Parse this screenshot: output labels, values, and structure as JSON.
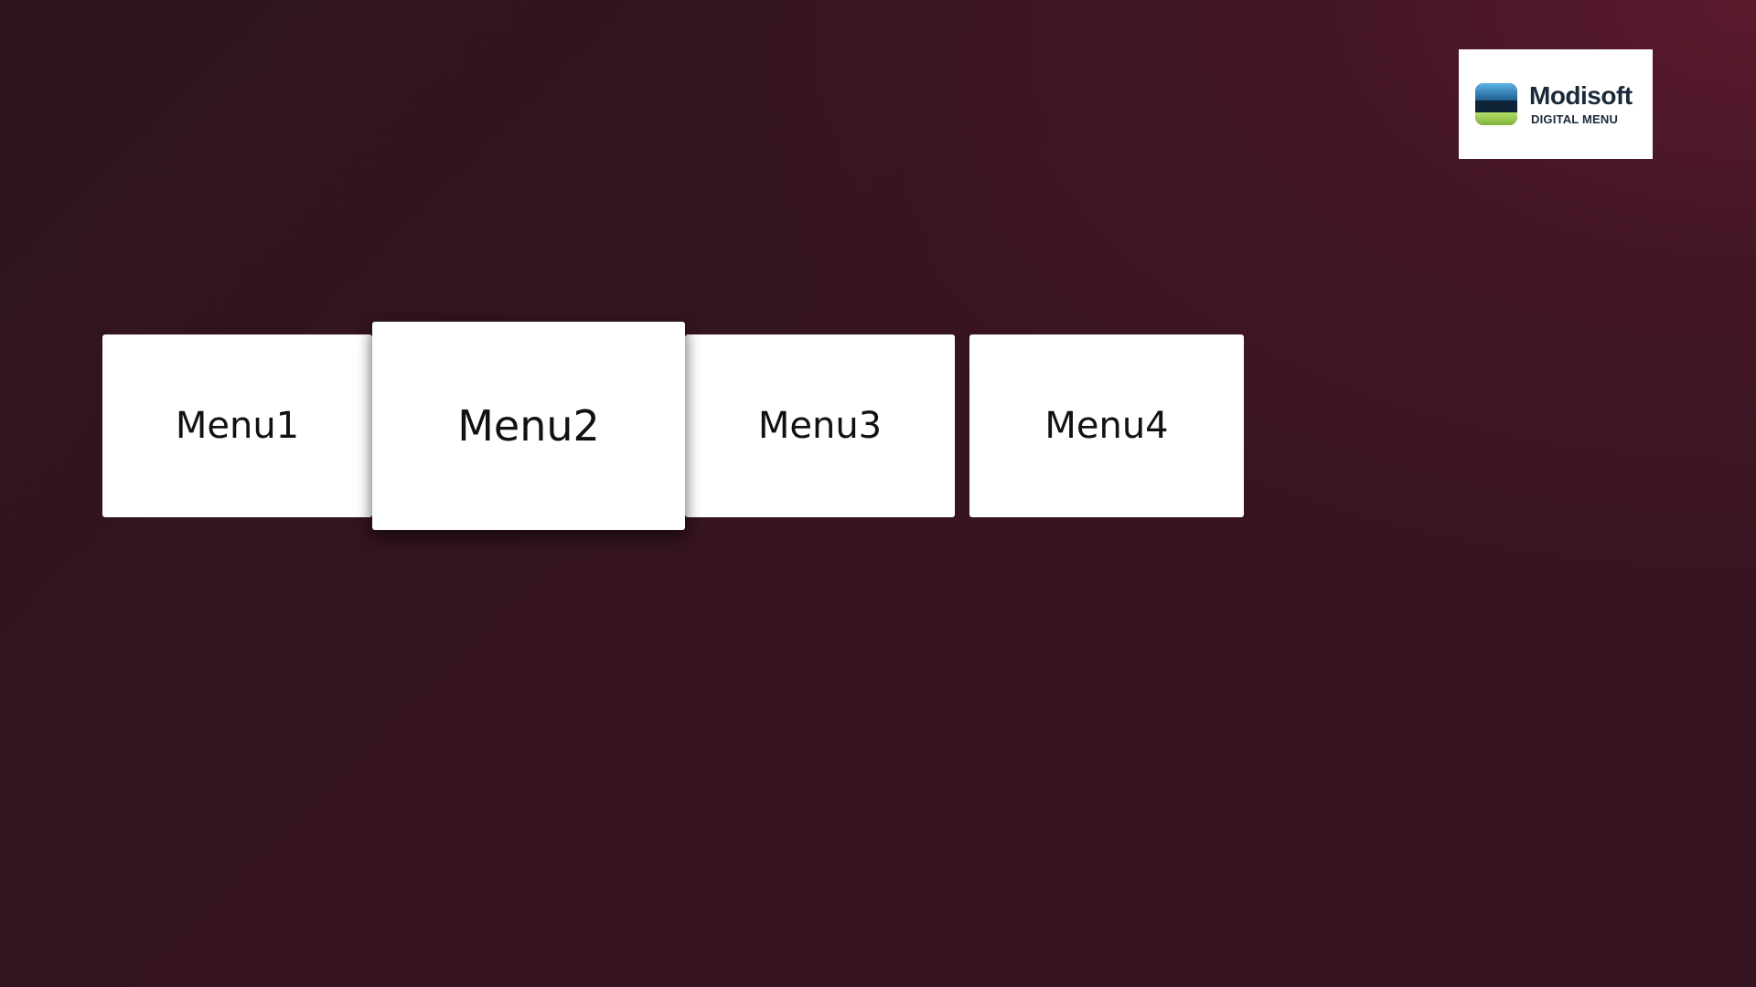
{
  "brand": {
    "name": "Modisoft",
    "subtitle": "DIGITAL MENU",
    "logo_icon": "modisoft-logo-icon",
    "colors": {
      "logo_top": "#2f7fb8",
      "logo_band": "#0f2436",
      "logo_bottom": "#9ccc4a"
    }
  },
  "menus": {
    "selected_index": 1,
    "items": [
      {
        "label": "Menu1"
      },
      {
        "label": "Menu2"
      },
      {
        "label": "Menu3"
      },
      {
        "label": "Menu4"
      }
    ]
  },
  "theme": {
    "background": "#361421",
    "background_highlight": "#5c1a2d",
    "card": "#ffffff",
    "text": "#111111"
  }
}
